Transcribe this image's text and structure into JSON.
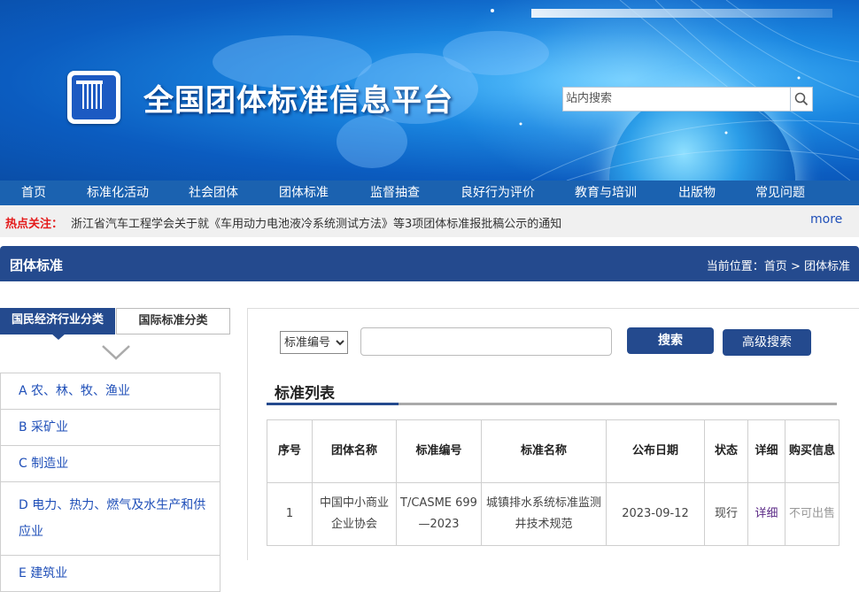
{
  "site": {
    "title": "全国团体标准信息平台",
    "search_placeholder": "站内搜索"
  },
  "nav": [
    "首页",
    "标准化活动",
    "社会团体",
    "团体标准",
    "监督抽查",
    "良好行为评价",
    "教育与培训",
    "出版物",
    "常见问题"
  ],
  "notice": {
    "label": "热点关注：",
    "text": "浙江省汽车工程学会关于就《车用动力电池液冷系统测试方法》等3项团体标准报批稿公示的通知",
    "more": "more"
  },
  "section": {
    "title": "团体标准",
    "breadcrumb_prefix": "当前位置：",
    "breadcrumb_home": "首页",
    "breadcrumb_sep": ">",
    "breadcrumb_current": "团体标准"
  },
  "sidebar": {
    "tab_active": "国民经济行业分类",
    "tab_inactive": "国际标准分类",
    "categories": [
      "A 农、林、牧、渔业",
      "B 采矿业",
      "C 制造业",
      "D 电力、热力、燃气及水生产和供应业",
      "E 建筑业"
    ]
  },
  "search": {
    "select_value": "标准编号",
    "keyword": "",
    "search_button": "搜索",
    "advanced_button": "高级搜索"
  },
  "list": {
    "title": "标准列表",
    "columns": [
      "序号",
      "团体名称",
      "标准编号",
      "标准名称",
      "公布日期",
      "状态",
      "详细",
      "购买信息"
    ],
    "rows": [
      {
        "index": "1",
        "org": "中国中小商业企业协会",
        "code": "T/CASME 699—2023",
        "name": "城镇排水系统标准监测井技术规范",
        "date": "2023-09-12",
        "status": "现行",
        "detail": "详细",
        "buy": "不可出售"
      }
    ]
  },
  "colors": {
    "nav_bg": "#1b62b0",
    "section_bg": "#244a8e",
    "hot_label": "#e41b1b",
    "link": "#1f4fb8"
  }
}
